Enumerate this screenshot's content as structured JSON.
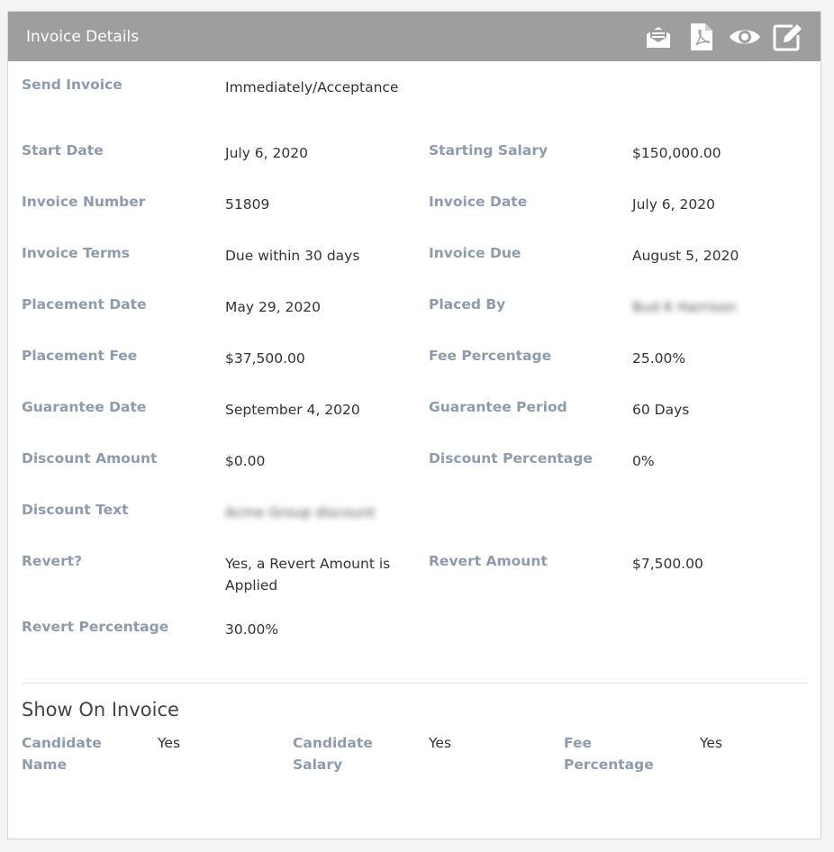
{
  "panel": {
    "title": "Invoice Details",
    "icons": [
      "email-icon",
      "pdf-icon",
      "view-eye-icon",
      "edit-icon"
    ]
  },
  "rows": {
    "send_invoice": {
      "label": "Send Invoice",
      "value": "Immediately/Acceptance"
    },
    "start_date": {
      "label": "Start Date",
      "value": "July 6, 2020"
    },
    "starting_salary": {
      "label": "Starting Salary",
      "value": "$150,000.00"
    },
    "invoice_number": {
      "label": "Invoice Number",
      "value": "51809"
    },
    "invoice_date": {
      "label": "Invoice Date",
      "value": "July 6, 2020"
    },
    "invoice_terms": {
      "label": "Invoice Terms",
      "value": "Due within 30 days"
    },
    "invoice_due": {
      "label": "Invoice Due",
      "value": "August 5, 2020"
    },
    "placement_date": {
      "label": "Placement Date",
      "value": "May 29, 2020"
    },
    "placed_by": {
      "label": "Placed By",
      "value": "Bud K Harrison"
    },
    "placement_fee": {
      "label": "Placement Fee",
      "value": "$37,500.00"
    },
    "fee_percentage": {
      "label": "Fee Percentage",
      "value": "25.00%"
    },
    "guarantee_date": {
      "label": "Guarantee Date",
      "value": "September 4, 2020"
    },
    "guarantee_period": {
      "label": "Guarantee Period",
      "value": "60 Days"
    },
    "discount_amount": {
      "label": "Discount Amount",
      "value": "$0.00"
    },
    "discount_percentage": {
      "label": "Discount Percentage",
      "value": "0%"
    },
    "discount_text": {
      "label": "Discount Text",
      "value": "Acme Group discount"
    },
    "revert": {
      "label": "Revert?",
      "value": "Yes, a Revert Amount is Applied"
    },
    "revert_amount": {
      "label": "Revert Amount",
      "value": "$7,500.00"
    },
    "revert_percentage": {
      "label": "Revert Percentage",
      "value": "30.00%"
    }
  },
  "show_on_invoice": {
    "title": "Show On Invoice",
    "candidate_name": {
      "label": "Candidate Name",
      "value": "Yes"
    },
    "candidate_salary": {
      "label": "Candidate Salary",
      "value": "Yes"
    },
    "fee_percentage": {
      "label": "Fee Percentage",
      "value": "Yes"
    }
  }
}
